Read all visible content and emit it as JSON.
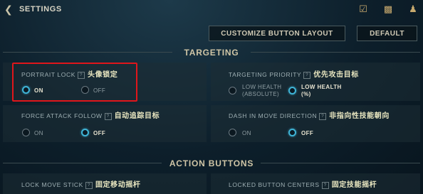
{
  "header": {
    "back_icon": "chevron-left-icon",
    "title": "SETTINGS",
    "icons": [
      "checklist-icon",
      "chat-icon",
      "friends-icon"
    ]
  },
  "actions": {
    "customize_label": "CUSTOMIZE BUTTON LAYOUT",
    "default_label": "DEFAULT"
  },
  "sections": {
    "targeting": "TARGETING",
    "action_buttons": "ACTION BUTTONS"
  },
  "settings": {
    "portrait_lock": {
      "label": "PORTRAIT LOCK",
      "cn": "头像锁定",
      "on": "ON",
      "off": "OFF",
      "selected": "ON"
    },
    "targeting_priority": {
      "label": "TARGETING PRIORITY",
      "cn": "优先攻击目标",
      "opt1_line1": "LOW HEALTH",
      "opt1_line2": "(ABSOLUTE)",
      "opt2_line1": "LOW HEALTH",
      "opt2_line2": "(%)",
      "selected": "LOW HEALTH (%)"
    },
    "force_attack_follow": {
      "label": "FORCE ATTACK FOLLOW",
      "cn": "自动追踪目标",
      "on": "ON",
      "off": "OFF",
      "selected": "OFF"
    },
    "dash_in_move_direction": {
      "label": "DASH IN MOVE DIRECTION",
      "cn": "非指向性技能朝向",
      "on": "ON",
      "off": "OFF",
      "selected": "OFF"
    },
    "lock_move_stick": {
      "label": "LOCK MOVE STICK",
      "cn": "固定移动摇杆"
    },
    "locked_button_centers": {
      "label": "LOCKED BUTTON CENTERS",
      "cn": "固定技能摇杆"
    }
  },
  "colors": {
    "accent": "#3fb4d6",
    "highlight": "#e0161b",
    "gold": "#c8aa6e"
  }
}
